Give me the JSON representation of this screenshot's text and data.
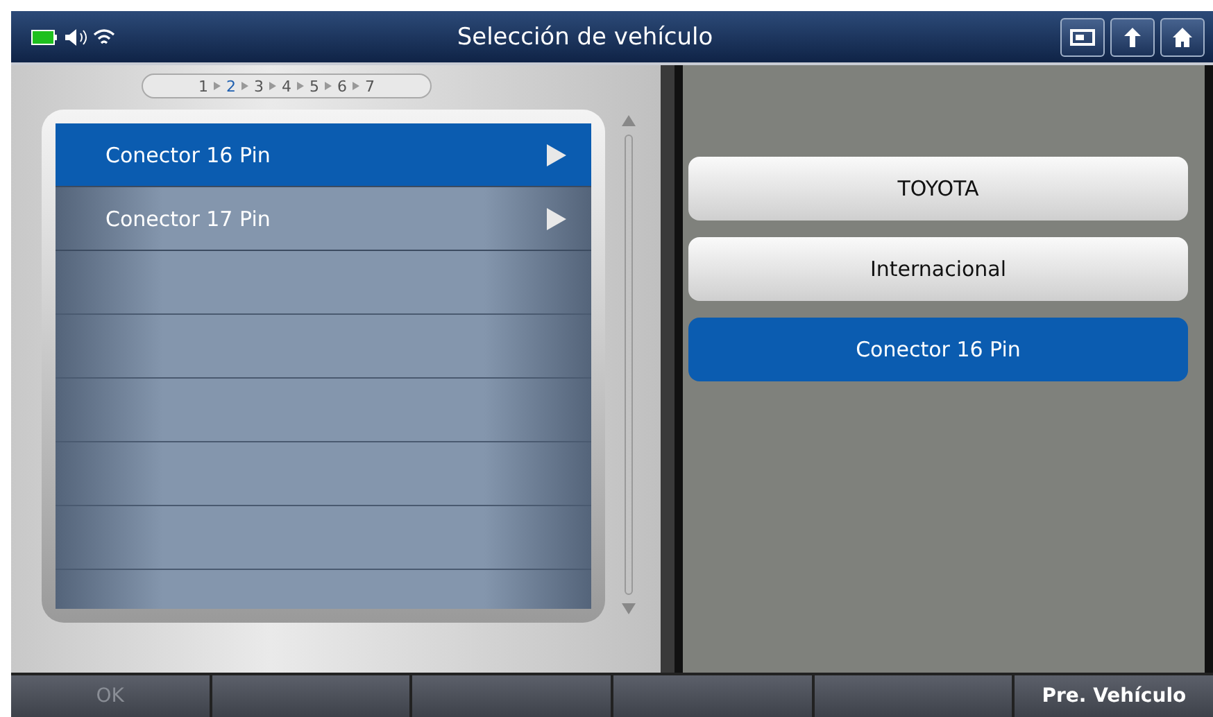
{
  "window": {
    "title": "Selección de vehículo"
  },
  "steps": [
    {
      "label": "1",
      "selected": false
    },
    {
      "label": "2",
      "selected": true
    },
    {
      "label": "3",
      "selected": false
    },
    {
      "label": "4",
      "selected": false
    },
    {
      "label": "5",
      "selected": false
    },
    {
      "label": "6",
      "selected": false
    },
    {
      "label": "7",
      "selected": false
    }
  ],
  "list": [
    {
      "label": "Conector 16 Pin",
      "selected": true
    },
    {
      "label": "Conector 17 Pin",
      "selected": false
    }
  ],
  "path": [
    {
      "label": "TOYOTA",
      "selected": false
    },
    {
      "label": "Internacional",
      "selected": false
    },
    {
      "label": "Conector 16 Pin",
      "selected": true
    }
  ],
  "buttons": [
    {
      "label": "OK",
      "disabled": true
    },
    {
      "label": "Pre. Vehículo",
      "disabled": false
    }
  ]
}
